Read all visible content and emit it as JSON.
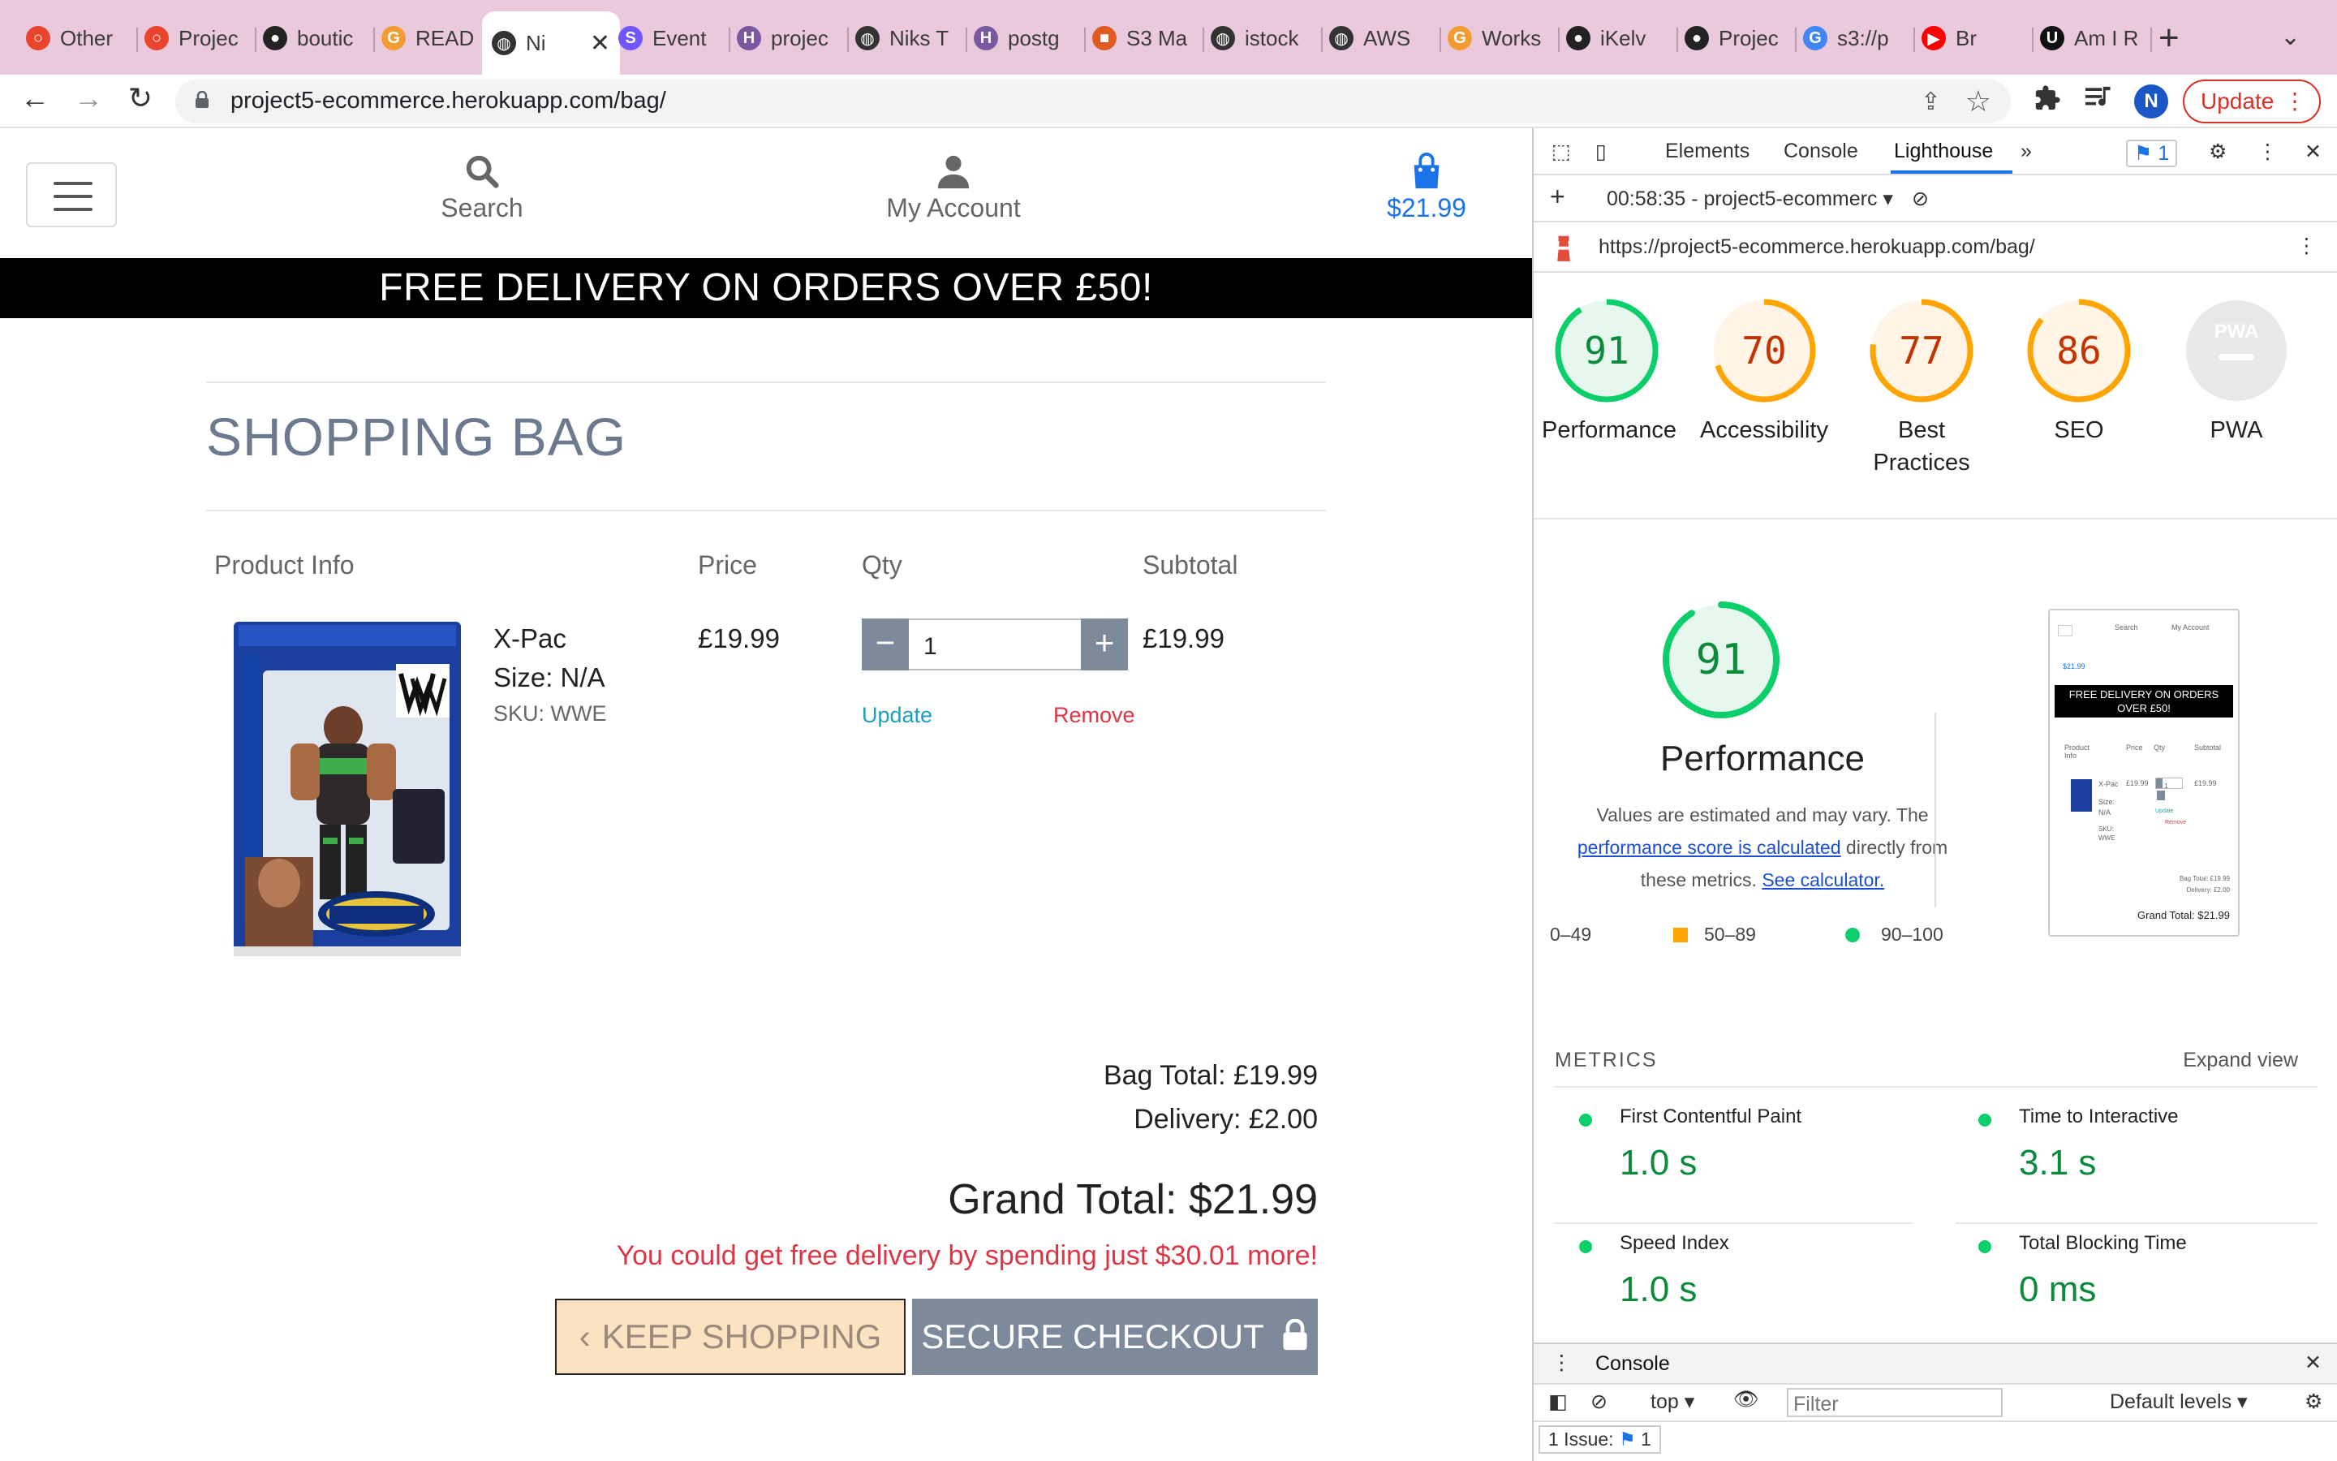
{
  "browser": {
    "tabs": [
      {
        "label": "Other",
        "icon": "opera-circle-icon",
        "color": "#e8452c"
      },
      {
        "label": "Projec",
        "icon": "opera-circle-icon",
        "color": "#e8452c"
      },
      {
        "label": "boutic",
        "icon": "github-icon",
        "color": "#222222"
      },
      {
        "label": "READ",
        "icon": "gitpod-icon",
        "color": "#f39c31"
      },
      {
        "label": "Ni",
        "icon": "globe-icon",
        "color": "#333333",
        "active": true
      },
      {
        "label": "Event",
        "icon": "s-app-icon",
        "color": "#7057ff"
      },
      {
        "label": "projec",
        "icon": "heroku-icon",
        "color": "#79589f"
      },
      {
        "label": "Niks T",
        "icon": "globe-icon",
        "color": "#333333"
      },
      {
        "label": "postg",
        "icon": "heroku-icon",
        "color": "#79589f"
      },
      {
        "label": "S3 Ma",
        "icon": "aws-s3-icon",
        "color": "#e05a24"
      },
      {
        "label": "istock",
        "icon": "globe-icon",
        "color": "#333333"
      },
      {
        "label": "AWS",
        "icon": "globe-icon",
        "color": "#333333"
      },
      {
        "label": "Works",
        "icon": "gitpod-icon",
        "color": "#f39c31"
      },
      {
        "label": "iKelv",
        "icon": "github-icon",
        "color": "#222222"
      },
      {
        "label": "Projec",
        "icon": "github-icon",
        "color": "#222222"
      },
      {
        "label": "s3://p",
        "icon": "google-icon",
        "color": "#4285f4"
      },
      {
        "label": "Br",
        "icon": "youtube-icon",
        "color": "#ff0000"
      },
      {
        "label": "Am I R",
        "icon": "u-icon",
        "color": "#111111"
      }
    ],
    "new_tab": "+",
    "url": "project5-ecommerce.herokuapp.com/bag/",
    "profile_initial": "N",
    "update_label": "Update"
  },
  "site": {
    "search_label": "Search",
    "account_label": "My Account",
    "bag_total": "$21.99",
    "banner": "FREE DELIVERY ON ORDERS OVER £50!",
    "title": "SHOPPING BAG",
    "columns": {
      "product": "Product Info",
      "price": "Price",
      "qty": "Qty",
      "subtotal": "Subtotal"
    },
    "item": {
      "name": "X-Pac",
      "size": "Size: N/A",
      "sku": "SKU: WWE",
      "price": "£19.99",
      "qty": "1",
      "subtotal": "£19.99",
      "update": "Update",
      "remove": "Remove"
    },
    "bag_total_line": "Bag Total: £19.99",
    "delivery_line": "Delivery: £2.00",
    "grand_total_line": "Grand Total: $21.99",
    "free_delivery_msg": "You could get free delivery by spending just $30.01 more!",
    "keep_shopping": "KEEP SHOPPING",
    "secure_checkout": "SECURE CHECKOUT"
  },
  "devtools": {
    "tabs": [
      "Elements",
      "Console",
      "Lighthouse"
    ],
    "active_tab": "Lighthouse",
    "issues_badge": "1",
    "report_select": "00:58:35 - project5-ecommerc",
    "report_url": "https://project5-ecommerce.herokuapp.com/bag/",
    "scores": [
      {
        "label": "Performance",
        "score": 91,
        "color": "#0cce6b",
        "text_color": "#0a8a3a",
        "bg": "#e6f8ee"
      },
      {
        "label": "Accessibility",
        "score": 70,
        "color": "#ffa400",
        "text_color": "#c33300",
        "bg": "#fff4e5"
      },
      {
        "label": "Best Practices",
        "score": 77,
        "color": "#ffa400",
        "text_color": "#c33300",
        "bg": "#fff4e5"
      },
      {
        "label": "SEO",
        "score": 86,
        "color": "#ffa400",
        "text_color": "#c33300",
        "bg": "#fff4e5"
      },
      {
        "label": "PWA",
        "score": null,
        "color": "#cccccc",
        "text_color": "#aaaaaa",
        "bg": "#e8e8e8"
      }
    ],
    "pwa_badge": "PWA",
    "perf_big_score": "91",
    "perf_title": "Performance",
    "perf_desc_1": "Values are estimated and may vary. The",
    "perf_desc_link": "performance score is calculated",
    "perf_desc_2": "directly from",
    "perf_desc_3": "these metrics.",
    "perf_desc_calc": "See calculator.",
    "legend": [
      "0–49",
      "50–89",
      "90–100"
    ],
    "metrics_heading": "METRICS",
    "expand_view": "Expand view",
    "metrics": [
      {
        "name": "First Contentful Paint",
        "value": "1.0 s"
      },
      {
        "name": "Time to Interactive",
        "value": "3.1 s"
      },
      {
        "name": "Speed Index",
        "value": "1.0 s"
      },
      {
        "name": "Total Blocking Time",
        "value": "0 ms"
      }
    ],
    "thumb": {
      "search": "Search",
      "account": "My Account",
      "price": "$21.99",
      "banner": "FREE DELIVERY ON ORDERS OVER £50!",
      "col1": "Product Info",
      "col2": "Price",
      "col3": "Qty",
      "col4": "Subtotal",
      "name": "X-Pac",
      "size": "Size: N/A",
      "sku": "SKU: WWE",
      "price_item": "£19.99",
      "qty": "1",
      "subtotal": "£19.99",
      "update": "Update",
      "remove": "Remove",
      "bag_total": "Bag Total: £19.99",
      "delivery": "Delivery: £2.00",
      "grand": "Grand Total: $21.99"
    },
    "drawer_title": "Console",
    "context": "top",
    "filter_placeholder": "Filter",
    "levels": "Default levels",
    "issues_line": "1 Issue:",
    "issues_count": "1"
  }
}
